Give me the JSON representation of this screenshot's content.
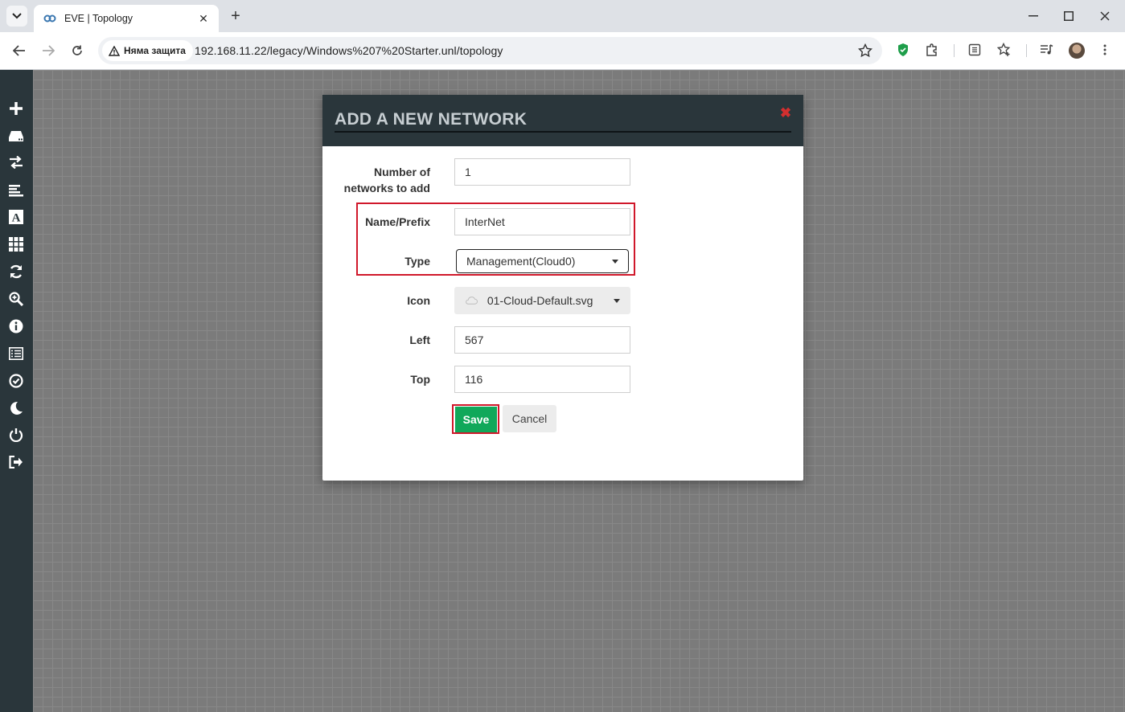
{
  "browser": {
    "tab_title": "EVE | Topology",
    "security_label": "Няма защита",
    "url": "192.168.11.22/legacy/Windows%207%20Starter.unl/topology"
  },
  "sidebar": {
    "items": [
      "add-icon",
      "node-icon",
      "network-icon",
      "list-icon",
      "text-icon",
      "grid-icon",
      "refresh-icon",
      "zoom-icon",
      "info-icon",
      "log-icon",
      "status-icon",
      "dark-mode-icon",
      "power-icon",
      "logout-icon"
    ]
  },
  "modal": {
    "title": "ADD A NEW NETWORK",
    "close_symbol": "✖",
    "fields": {
      "count_label_line1": "Number of",
      "count_label_line2": "networks to add",
      "count_value": "1",
      "name_label": "Name/Prefix",
      "name_value": "InterNet",
      "type_label": "Type",
      "type_value": "Management(Cloud0)",
      "icon_label": "Icon",
      "icon_value": "01-Cloud-Default.svg",
      "left_label": "Left",
      "left_value": "567",
      "top_label": "Top",
      "top_value": "116"
    },
    "save_label": "Save",
    "cancel_label": "Cancel"
  },
  "colors": {
    "highlight": "#d0182b",
    "save_button": "#10a85a",
    "header": "#2a363b"
  }
}
